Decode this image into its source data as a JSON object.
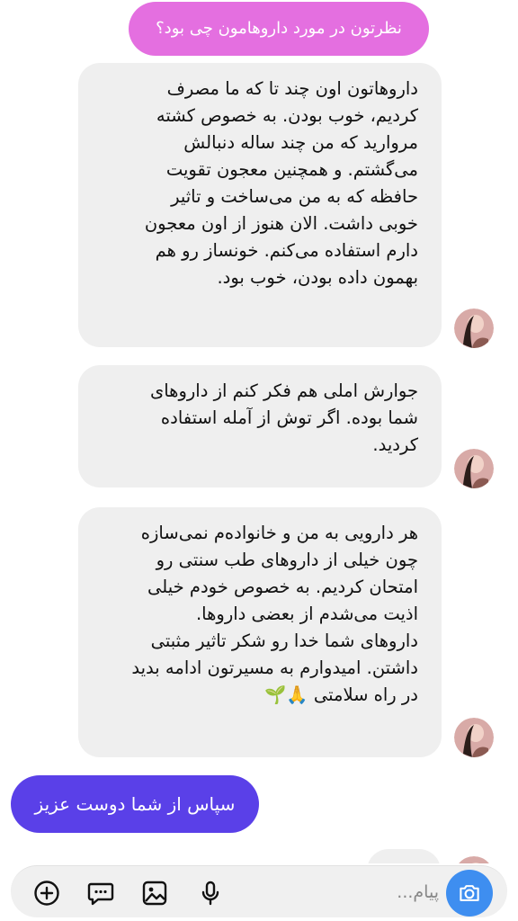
{
  "messages": {
    "question": "نظرتون در مورد داروهامون چی بود؟",
    "reply1": [
      "داروهاتون اون چند تا که ما مصرف",
      "کردیم، خوب بودن. به خصوص کشته",
      "مروارید که من چند ساله دنبالش",
      "می‌گشتم. و همچنین معجون تقویت",
      "حافظه که به من می‌ساخت و تاثیر",
      "خوبی داشت. الان هنوز از اون معجون",
      "دارم استفاده می‌کنم. خونساز رو هم",
      "بهمون داده بودن، خوب بود."
    ],
    "reply2": [
      "جوارش املی هم فکر کنم از داروهای",
      "شما بوده. اگر توش از آمله استفاده",
      "کردید."
    ],
    "reply3": [
      "هر دارویی به من و خانواده‌م نمی‌سازه",
      "چون خیلی از داروهای طب سنتی رو",
      "امتحان کردیم. به خصوص خودم خیلی",
      "اذیت می‌شدم از بعضی داروها.",
      "داروهای شما خدا رو شکر تاثیر مثبتی",
      "داشتن. امیدوارم به مسیرتون ادامه بدید",
      "در راه سلامتی 🙏🌱"
    ],
    "thanks": "سپاس از شما دوست عزیز"
  },
  "composer": {
    "placeholder": "پیام..."
  },
  "icons": {
    "camera": "camera-icon",
    "mic": "microphone-icon",
    "gallery": "image-icon",
    "sticker": "chat-bubble-icon",
    "add": "plus-circle-icon"
  },
  "colors": {
    "outgoing_pink": "#e46fe0",
    "outgoing_purple": "#5a40e8",
    "incoming_gray": "#efefef",
    "camera_blue": "#3e8ef0"
  }
}
